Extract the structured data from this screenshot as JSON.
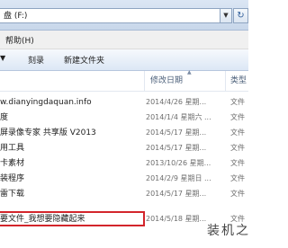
{
  "address": {
    "text": "盘 (F:)",
    "dropdown_icon": "chevron-down-icon",
    "refresh_icon": "refresh-icon"
  },
  "menu": {
    "help": "帮助(H)"
  },
  "toolbar": {
    "burn": "刻录",
    "new_folder": "新建文件夹"
  },
  "columns": {
    "date": "修改日期",
    "type": "类型"
  },
  "files": [
    {
      "name": "w.dianyingdaquan.info",
      "date": "2014/4/26 星期...",
      "type": "文件"
    },
    {
      "name": "度",
      "date": "2014/1/4 星期六 ...",
      "type": "文件"
    },
    {
      "name": "屏录像专家 共享版 V2013",
      "date": "2014/5/17 星期...",
      "type": "文件"
    },
    {
      "name": "用工具",
      "date": "2014/5/17 星期...",
      "type": "文件"
    },
    {
      "name": "卡素材",
      "date": "2013/10/26 星期...",
      "type": "文件"
    },
    {
      "name": "装程序",
      "date": "2014/2/9 星期日 ...",
      "type": "文件"
    },
    {
      "name": "雷下载",
      "date": "2014/5/17 星期...",
      "type": "文件"
    },
    {
      "name": "要文件_我想要隐藏起来",
      "date": "2014/5/18 星期...",
      "type": "文件"
    }
  ],
  "watermark": "装机之"
}
